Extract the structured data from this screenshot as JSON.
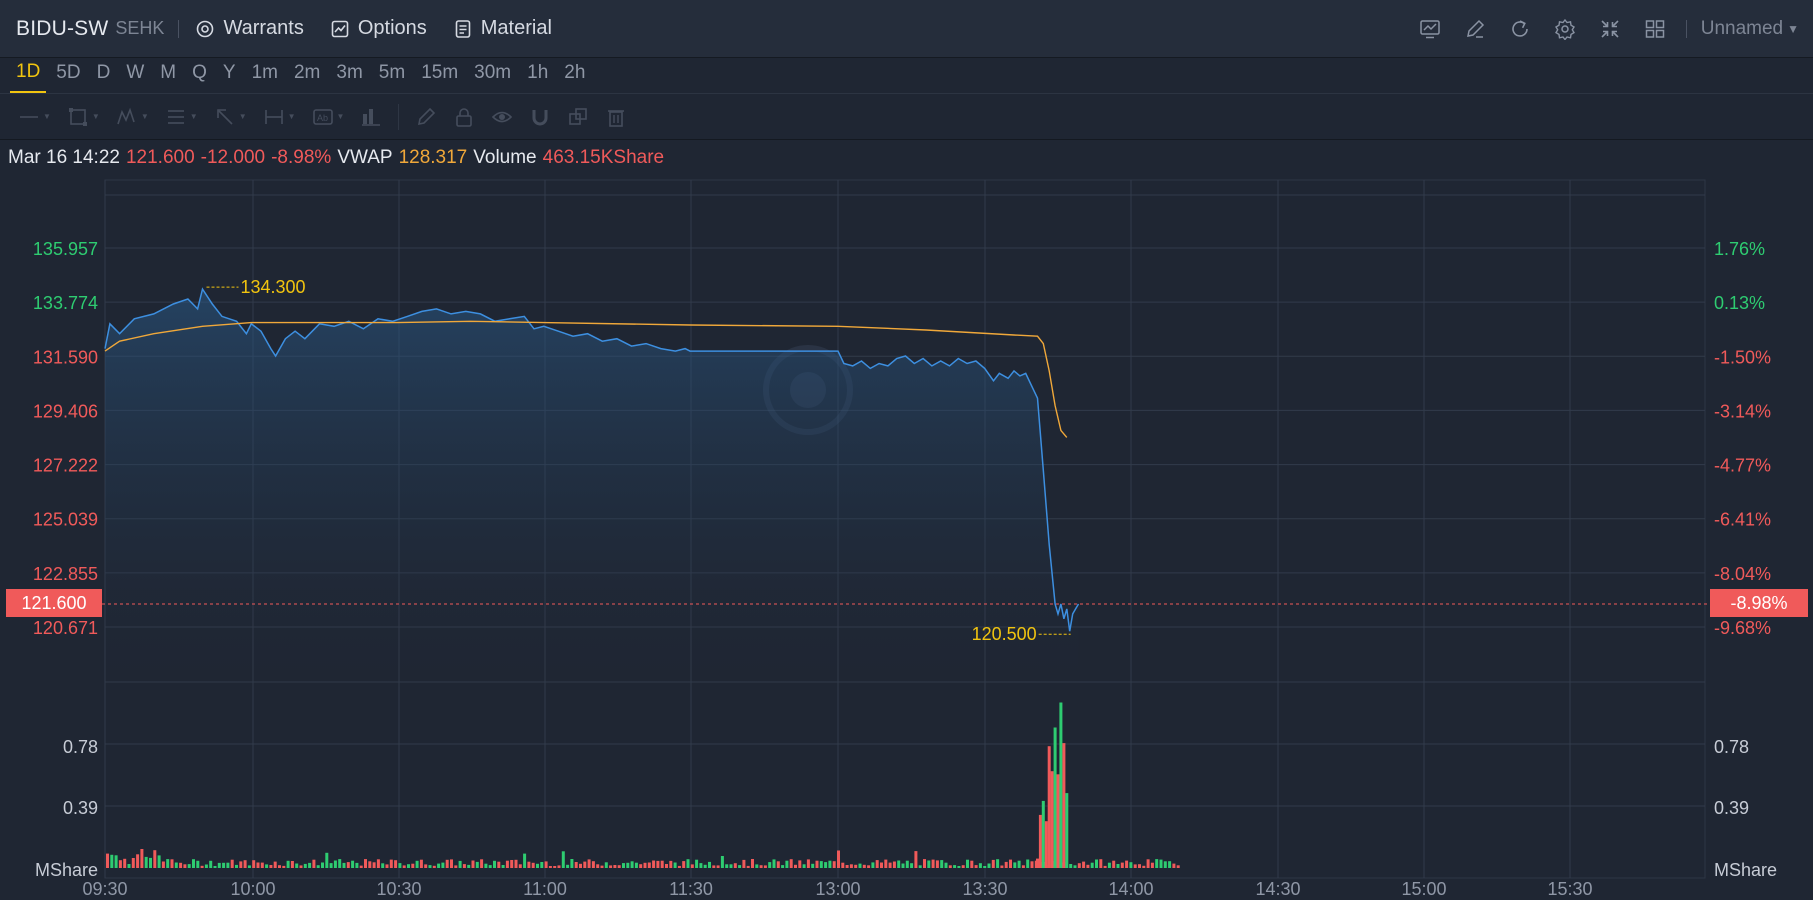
{
  "header": {
    "symbol": "BIDU-SW",
    "exchange": "SEHK",
    "buttons": [
      {
        "label": "Warrants",
        "icon": "warrants-icon"
      },
      {
        "label": "Options",
        "icon": "options-icon"
      },
      {
        "label": "Material",
        "icon": "material-icon"
      }
    ],
    "tool_icons": [
      "indicator-icon",
      "draw-icon",
      "refresh-icon",
      "settings-icon",
      "collapse-icon",
      "layout-grid-icon"
    ],
    "layout_name": "Unnamed"
  },
  "timeframes": {
    "items": [
      "1D",
      "5D",
      "D",
      "W",
      "M",
      "Q",
      "Y",
      "1m",
      "2m",
      "3m",
      "5m",
      "15m",
      "30m",
      "1h",
      "2h"
    ],
    "active": "1D"
  },
  "drawing_tools": [
    "line-tool-icon",
    "rect-tool-icon",
    "pattern-tool-icon",
    "fib-tool-icon",
    "arrow-tool-icon",
    "measure-tool-icon",
    "text-tool-icon",
    "bars-tool-icon",
    "pencil-icon",
    "lock-icon",
    "eye-icon",
    "magnet-icon",
    "clone-icon",
    "trash-icon"
  ],
  "info": {
    "datetime": "Mar 16 14:22",
    "price": "121.600",
    "change": "-12.000",
    "change_pct": "-8.98%",
    "vwap_label": "VWAP",
    "vwap": "128.317",
    "volume_label": "Volume",
    "volume": "463.15KShare"
  },
  "colors": {
    "background": "#1f2633",
    "price_line": "#3d8fe0",
    "vwap_line": "#f0a83a",
    "up": "#2ecc71",
    "down": "#f05a5a",
    "highlight": "#f1c40f"
  },
  "chart_data": {
    "type": "line",
    "price_axis_left": [
      "135.957",
      "133.774",
      "131.590",
      "129.406",
      "127.222",
      "125.039",
      "122.855",
      "120.671"
    ],
    "price_axis_right": [
      "1.76%",
      "0.13%",
      "-1.50%",
      "-3.14%",
      "-4.77%",
      "-6.41%",
      "-8.04%",
      "-9.68%"
    ],
    "ylim": [
      120.671,
      135.957
    ],
    "x_ticks": [
      "09:30",
      "10:00",
      "10:30",
      "11:00",
      "11:30",
      "13:00",
      "13:30",
      "14:00",
      "14:30",
      "15:00",
      "15:30"
    ],
    "current_price_label": "121.600",
    "current_pct_label": "-8.98%",
    "high_marker": {
      "label": "134.300",
      "time": "09:50",
      "value": 134.3
    },
    "low_marker": {
      "label": "120.500",
      "time": "14:20",
      "value": 120.5
    },
    "series": [
      {
        "name": "",
        "kind": "price",
        "points": [
          [
            "09:30",
            131.9
          ],
          [
            "09:31",
            132.9
          ],
          [
            "09:33",
            132.5
          ],
          [
            "09:36",
            133.1
          ],
          [
            "09:40",
            133.3
          ],
          [
            "09:44",
            133.7
          ],
          [
            "09:47",
            133.9
          ],
          [
            "09:49",
            133.5
          ],
          [
            "09:50",
            134.3
          ],
          [
            "09:52",
            133.7
          ],
          [
            "09:54",
            133.2
          ],
          [
            "09:57",
            133.0
          ],
          [
            "09:59",
            132.5
          ],
          [
            "10:00",
            132.9
          ],
          [
            "10:02",
            132.6
          ],
          [
            "10:04",
            131.9
          ],
          [
            "10:05",
            131.6
          ],
          [
            "10:07",
            132.3
          ],
          [
            "10:09",
            132.6
          ],
          [
            "10:11",
            132.3
          ],
          [
            "10:14",
            132.9
          ],
          [
            "10:17",
            132.8
          ],
          [
            "10:20",
            133.0
          ],
          [
            "10:23",
            132.7
          ],
          [
            "10:26",
            133.1
          ],
          [
            "10:29",
            133.0
          ],
          [
            "10:32",
            133.2
          ],
          [
            "10:35",
            133.4
          ],
          [
            "10:38",
            133.5
          ],
          [
            "10:41",
            133.3
          ],
          [
            "10:44",
            133.4
          ],
          [
            "10:47",
            133.3
          ],
          [
            "10:50",
            133.0
          ],
          [
            "10:53",
            133.1
          ],
          [
            "10:56",
            133.2
          ],
          [
            "10:58",
            132.7
          ],
          [
            "11:00",
            132.8
          ],
          [
            "11:03",
            132.6
          ],
          [
            "11:06",
            132.4
          ],
          [
            "11:09",
            132.5
          ],
          [
            "11:12",
            132.2
          ],
          [
            "11:15",
            132.3
          ],
          [
            "11:18",
            132.0
          ],
          [
            "11:21",
            132.1
          ],
          [
            "11:24",
            131.9
          ],
          [
            "11:27",
            131.8
          ],
          [
            "11:29",
            131.9
          ],
          [
            "11:30",
            131.8
          ],
          [
            "13:00",
            131.8
          ],
          [
            "13:02",
            131.3
          ],
          [
            "13:05",
            131.2
          ],
          [
            "13:08",
            131.4
          ],
          [
            "13:11",
            131.1
          ],
          [
            "13:14",
            131.3
          ],
          [
            "13:17",
            131.2
          ],
          [
            "13:20",
            131.5
          ],
          [
            "13:23",
            131.6
          ],
          [
            "13:26",
            131.3
          ],
          [
            "13:29",
            131.5
          ],
          [
            "13:32",
            131.2
          ],
          [
            "13:35",
            131.4
          ],
          [
            "13:38",
            131.2
          ],
          [
            "13:41",
            131.5
          ],
          [
            "13:44",
            131.3
          ],
          [
            "13:47",
            131.4
          ],
          [
            "13:50",
            131.1
          ],
          [
            "13:53",
            130.6
          ],
          [
            "13:55",
            130.9
          ],
          [
            "13:58",
            130.7
          ],
          [
            "14:00",
            131.0
          ],
          [
            "14:02",
            130.8
          ],
          [
            "14:04",
            130.9
          ],
          [
            "14:06",
            130.4
          ],
          [
            "14:08",
            129.9
          ],
          [
            "14:10",
            127.0
          ],
          [
            "14:12",
            124.0
          ],
          [
            "14:14",
            121.6
          ],
          [
            "14:15",
            121.2
          ],
          [
            "14:16",
            121.6
          ],
          [
            "14:17",
            121.0
          ],
          [
            "14:18",
            121.4
          ],
          [
            "14:19",
            120.5
          ],
          [
            "14:20",
            121.2
          ],
          [
            "14:21",
            121.4
          ],
          [
            "14:22",
            121.6
          ]
        ]
      },
      {
        "name": "VWAP",
        "kind": "vwap",
        "points": [
          [
            "09:30",
            131.8
          ],
          [
            "09:33",
            132.2
          ],
          [
            "09:40",
            132.5
          ],
          [
            "09:50",
            132.8
          ],
          [
            "10:00",
            132.95
          ],
          [
            "10:15",
            132.95
          ],
          [
            "10:30",
            132.95
          ],
          [
            "10:45",
            133.0
          ],
          [
            "11:00",
            132.95
          ],
          [
            "11:30",
            132.85
          ],
          [
            "13:00",
            132.8
          ],
          [
            "13:30",
            132.65
          ],
          [
            "14:00",
            132.45
          ],
          [
            "14:08",
            132.4
          ],
          [
            "14:10",
            132.1
          ],
          [
            "14:12",
            131.0
          ],
          [
            "14:14",
            129.6
          ],
          [
            "14:16",
            128.6
          ],
          [
            "14:18",
            128.32
          ]
        ]
      }
    ],
    "volume": {
      "axis_left": [
        "0.78",
        "0.39"
      ],
      "axis_right": [
        "0.78",
        "0.39"
      ],
      "unit_left": "MShare",
      "unit_right": "MShare",
      "spikes": [
        [
          "14:08",
          0.06,
          "down"
        ],
        [
          "14:09",
          0.34,
          "down"
        ],
        [
          "14:10",
          0.43,
          "up"
        ],
        [
          "14:11",
          0.3,
          "down"
        ],
        [
          "14:12",
          0.78,
          "down"
        ],
        [
          "14:13",
          0.62,
          "down"
        ],
        [
          "14:14",
          0.9,
          "up"
        ],
        [
          "14:15",
          0.6,
          "down"
        ],
        [
          "14:16",
          1.06,
          "up"
        ],
        [
          "14:17",
          0.8,
          "down"
        ],
        [
          "14:18",
          0.48,
          "up"
        ]
      ]
    }
  }
}
